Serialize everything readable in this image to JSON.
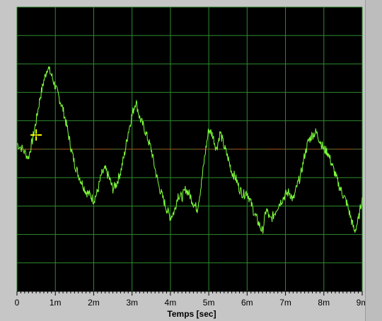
{
  "chart_data": {
    "type": "line",
    "xlabel": "Temps [sec]",
    "ylabel": "",
    "xlim": [
      0,
      9
    ],
    "ylim": [
      -5,
      5
    ],
    "x_ticks": [
      "0",
      "1m",
      "2m",
      "3m",
      "4m",
      "5m",
      "6m",
      "7m",
      "8m",
      "9m"
    ],
    "grid": true,
    "colors": {
      "background": "#000000",
      "grid": "#2e8b2e",
      "trace": "#7dff3a",
      "reference": "#b05a2a",
      "cursor": "#ffff00"
    },
    "series": [
      {
        "x": [
          0,
          0.15,
          0.3,
          0.4,
          0.5,
          0.6,
          0.7,
          0.8,
          0.9,
          1.0,
          1.1,
          1.2,
          1.3,
          1.4,
          1.5,
          1.6,
          1.7,
          1.8,
          1.9,
          2.0,
          2.1,
          2.2,
          2.3,
          2.4,
          2.5,
          2.6,
          2.7,
          2.8,
          2.9,
          3.0,
          3.1,
          3.2,
          3.3,
          3.4,
          3.5,
          3.6,
          3.7,
          3.8,
          3.9,
          4.0,
          4.1,
          4.2,
          4.3,
          4.4,
          4.5,
          4.6,
          4.7,
          4.8,
          4.9,
          5.0,
          5.1,
          5.2,
          5.3,
          5.4,
          5.5,
          5.6,
          5.7,
          5.8,
          5.9,
          6.0,
          6.1,
          6.2,
          6.3,
          6.4,
          6.5,
          6.6,
          6.7,
          6.8,
          6.9,
          7.0,
          7.1,
          7.2,
          7.3,
          7.4,
          7.5,
          7.6,
          7.7,
          7.8,
          7.9,
          8.0,
          8.1,
          8.2,
          8.3,
          8.4,
          8.5,
          8.6,
          8.7,
          8.8,
          8.9,
          9.0
        ],
        "y": [
          0.2,
          0.0,
          -0.3,
          0.3,
          1.0,
          1.8,
          2.4,
          2.9,
          2.6,
          2.2,
          1.8,
          1.4,
          0.8,
          0.1,
          -0.5,
          -0.9,
          -1.2,
          -1.5,
          -1.6,
          -1.8,
          -1.5,
          -0.9,
          -0.7,
          -1.0,
          -1.4,
          -1.2,
          -0.8,
          -0.2,
          0.6,
          1.2,
          1.7,
          1.1,
          0.8,
          0.4,
          0.0,
          -0.7,
          -1.3,
          -1.7,
          -2.1,
          -2.4,
          -2.2,
          -1.6,
          -1.7,
          -1.4,
          -1.6,
          -1.9,
          -2.1,
          -1.3,
          -0.2,
          0.7,
          0.5,
          0.0,
          0.6,
          0.1,
          -0.3,
          -0.8,
          -1.0,
          -1.4,
          -1.6,
          -1.5,
          -1.9,
          -2.3,
          -2.6,
          -2.9,
          -2.1,
          -2.5,
          -2.3,
          -2.0,
          -1.8,
          -1.6,
          -1.5,
          -1.8,
          -1.3,
          -0.9,
          -0.2,
          0.3,
          0.5,
          0.6,
          0.3,
          0.0,
          -0.1,
          -0.5,
          -0.9,
          -1.3,
          -1.6,
          -1.9,
          -2.4,
          -2.9,
          -2.5,
          -1.7
        ]
      }
    ],
    "reference_level": 0,
    "cursor": {
      "x": 0.5,
      "y": 0.5
    }
  }
}
